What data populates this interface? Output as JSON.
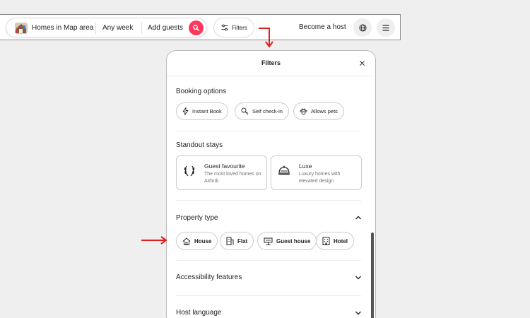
{
  "nav": {
    "location": "Homes in Map area",
    "dates": "Any week",
    "guests": "Add guests",
    "filters_label": "Filters",
    "host_link": "Become a host",
    "icons": {
      "map": "map-thumbnail-icon",
      "search": "search-icon",
      "filters": "sliders-icon",
      "globe": "globe-icon",
      "menu": "hamburger-menu-icon"
    },
    "accent_color": "#ff385c"
  },
  "modal": {
    "title": "Filters",
    "booking": {
      "title": "Booking options",
      "options": [
        {
          "label": "Instant Book",
          "icon": "lightning-icon"
        },
        {
          "label": "Self check-in",
          "icon": "key-icon"
        },
        {
          "label": "Allows pets",
          "icon": "paw-icon"
        }
      ]
    },
    "standout": {
      "title": "Standout stays",
      "cards": [
        {
          "title": "Guest favourite",
          "desc": "The most loved homes on Airbnb",
          "icon": "laurel-icon"
        },
        {
          "title": "Luxe",
          "desc": "Luxury homes with elevated design",
          "icon": "cloche-icon"
        }
      ]
    },
    "property": {
      "title": "Property type",
      "types": [
        {
          "label": "House",
          "icon": "house-icon"
        },
        {
          "label": "Flat",
          "icon": "building-icon"
        },
        {
          "label": "Guest house",
          "icon": "guest-house-icon"
        },
        {
          "label": "Hotel",
          "icon": "hotel-icon"
        }
      ]
    },
    "accessibility": {
      "title": "Accessibility features"
    },
    "host_language": {
      "title": "Host language"
    }
  },
  "annotation_color": "#e0201c"
}
